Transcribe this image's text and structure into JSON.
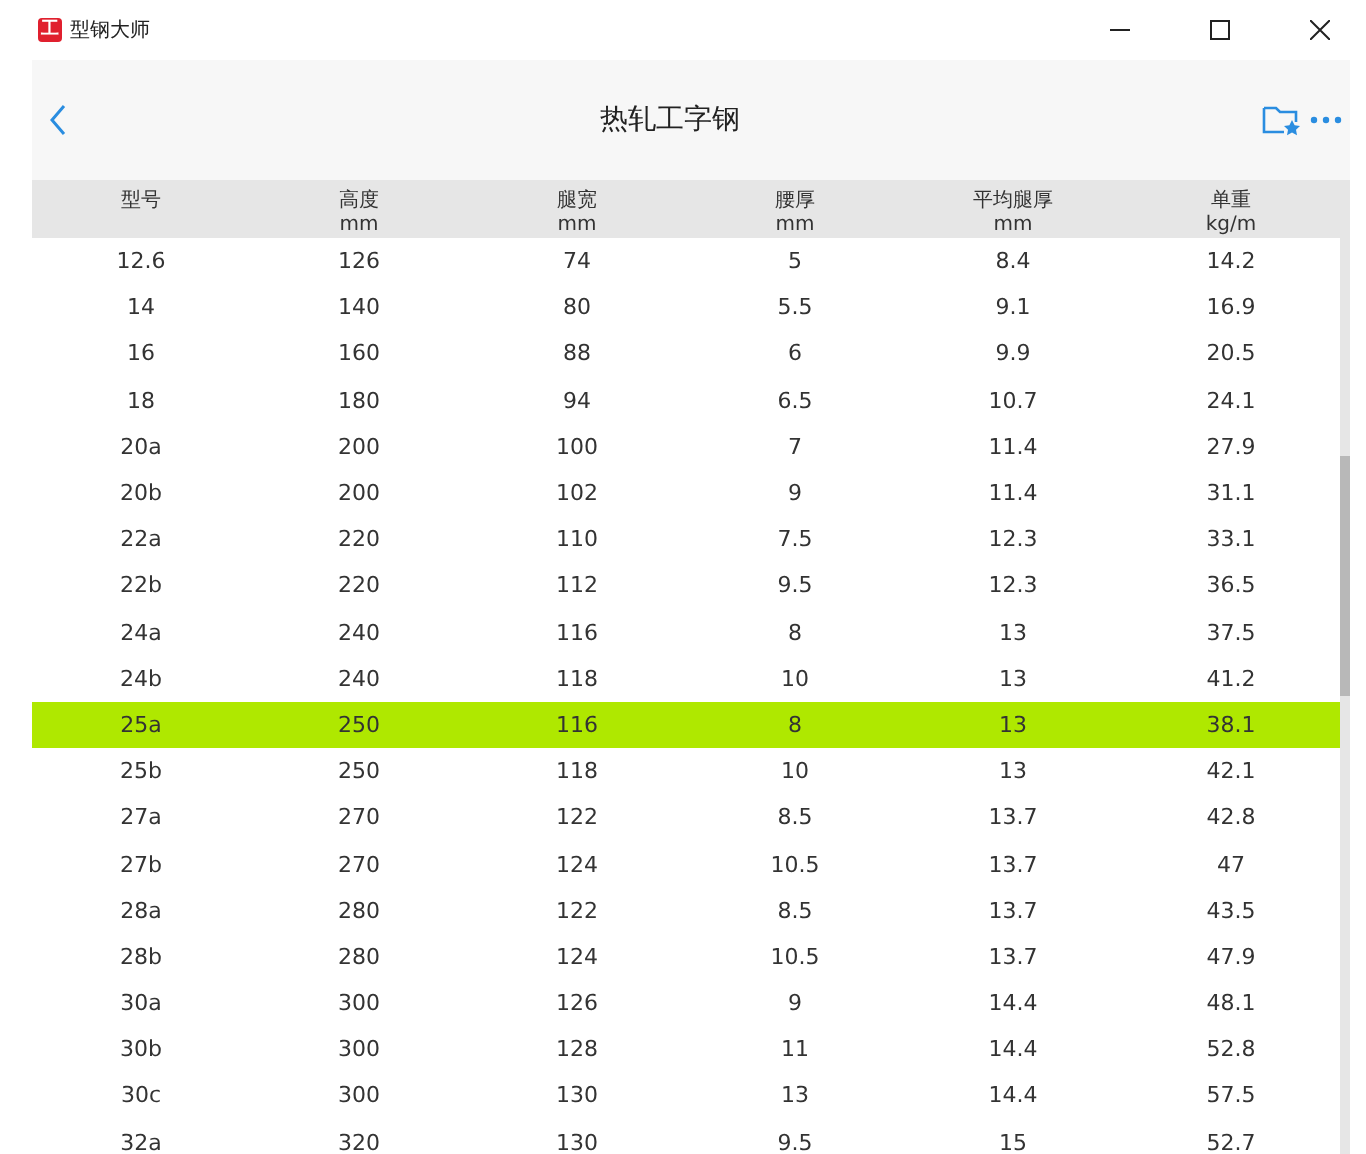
{
  "window": {
    "title": "型钢大师",
    "app_icon_text": "工"
  },
  "header": {
    "title": "热轧工字钢"
  },
  "table": {
    "columns": [
      {
        "name": "型号"
      },
      {
        "name": "高度",
        "unit": "mm"
      },
      {
        "name": "腿宽",
        "unit": "mm"
      },
      {
        "name": "腰厚",
        "unit": "mm"
      },
      {
        "name": "平均腿厚",
        "unit": "mm"
      },
      {
        "name": "单重",
        "unit": "kg/m"
      }
    ],
    "rows": [
      {
        "cells": [
          "12.6",
          "126",
          "74",
          "5",
          "8.4",
          "14.2"
        ],
        "selected": false
      },
      {
        "cells": [
          "14",
          "140",
          "80",
          "5.5",
          "9.1",
          "16.9"
        ],
        "selected": false
      },
      {
        "cells": [
          "16",
          "160",
          "88",
          "6",
          "9.9",
          "20.5"
        ],
        "selected": false
      },
      {
        "cells": [
          "18",
          "180",
          "94",
          "6.5",
          "10.7",
          "24.1"
        ],
        "selected": false
      },
      {
        "cells": [
          "20a",
          "200",
          "100",
          "7",
          "11.4",
          "27.9"
        ],
        "selected": false
      },
      {
        "cells": [
          "20b",
          "200",
          "102",
          "9",
          "11.4",
          "31.1"
        ],
        "selected": false
      },
      {
        "cells": [
          "22a",
          "220",
          "110",
          "7.5",
          "12.3",
          "33.1"
        ],
        "selected": false
      },
      {
        "cells": [
          "22b",
          "220",
          "112",
          "9.5",
          "12.3",
          "36.5"
        ],
        "selected": false
      },
      {
        "cells": [
          "24a",
          "240",
          "116",
          "8",
          "13",
          "37.5"
        ],
        "selected": false
      },
      {
        "cells": [
          "24b",
          "240",
          "118",
          "10",
          "13",
          "41.2"
        ],
        "selected": false
      },
      {
        "cells": [
          "25a",
          "250",
          "116",
          "8",
          "13",
          "38.1"
        ],
        "selected": true
      },
      {
        "cells": [
          "25b",
          "250",
          "118",
          "10",
          "13",
          "42.1"
        ],
        "selected": false
      },
      {
        "cells": [
          "27a",
          "270",
          "122",
          "8.5",
          "13.7",
          "42.8"
        ],
        "selected": false
      },
      {
        "cells": [
          "27b",
          "270",
          "124",
          "10.5",
          "13.7",
          "47"
        ],
        "selected": false
      },
      {
        "cells": [
          "28a",
          "280",
          "122",
          "8.5",
          "13.7",
          "43.5"
        ],
        "selected": false
      },
      {
        "cells": [
          "28b",
          "280",
          "124",
          "10.5",
          "13.7",
          "47.9"
        ],
        "selected": false
      },
      {
        "cells": [
          "30a",
          "300",
          "126",
          "9",
          "14.4",
          "48.1"
        ],
        "selected": false
      },
      {
        "cells": [
          "30b",
          "300",
          "128",
          "11",
          "14.4",
          "52.8"
        ],
        "selected": false
      },
      {
        "cells": [
          "30c",
          "300",
          "130",
          "13",
          "14.4",
          "57.5"
        ],
        "selected": false
      },
      {
        "cells": [
          "32a",
          "320",
          "130",
          "9.5",
          "15",
          "52.7"
        ],
        "selected": false
      }
    ]
  }
}
